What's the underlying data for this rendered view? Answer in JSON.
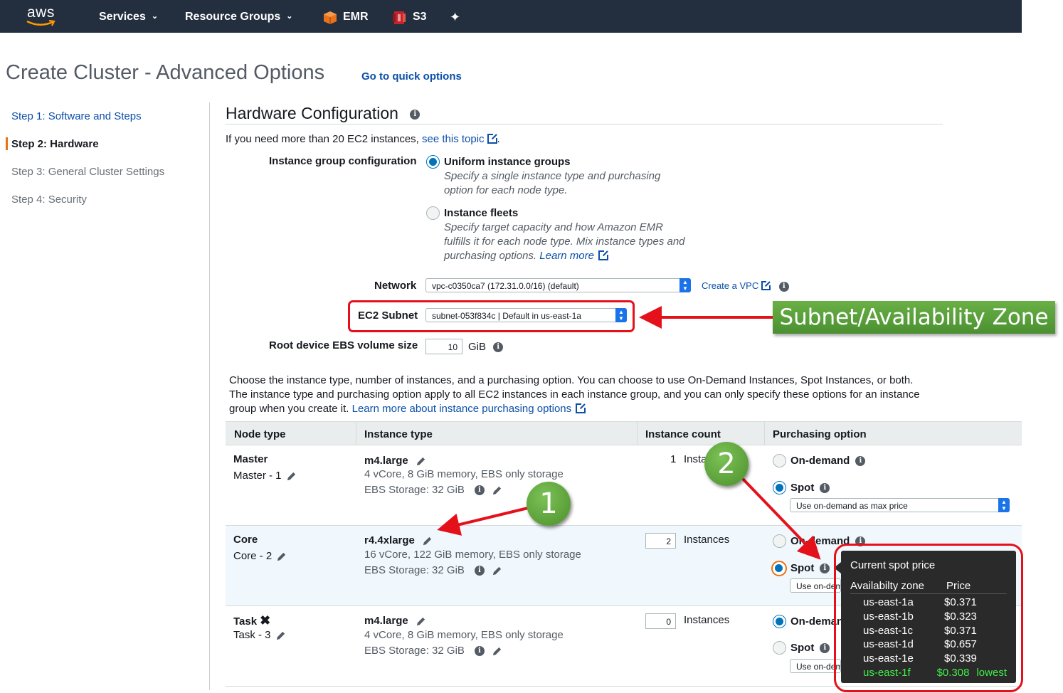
{
  "nav": {
    "logo": "aws",
    "services": "Services",
    "resource_groups": "Resource Groups",
    "emr": "EMR",
    "s3": "S3"
  },
  "page": {
    "title": "Create Cluster - Advanced Options",
    "quick_link": "Go to quick options"
  },
  "steps": [
    {
      "label": "Step 1: Software and Steps",
      "state": "link"
    },
    {
      "label": "Step 2: Hardware",
      "state": "active"
    },
    {
      "label": "Step 3: General Cluster Settings",
      "state": "muted"
    },
    {
      "label": "Step 4: Security",
      "state": "muted"
    }
  ],
  "hardware": {
    "title": "Hardware Configuration",
    "note_prefix": "If you need more than 20 EC2 instances,",
    "note_link": "see this topic",
    "note_suffix": ".",
    "instance_group_label": "Instance group configuration",
    "uniform": {
      "title": "Uniform instance groups",
      "desc1": "Specify a single instance type and purchasing",
      "desc2": "option for each node type.",
      "selected": true
    },
    "fleets": {
      "title": "Instance fleets",
      "desc1": "Specify target capacity and how Amazon EMR",
      "desc2": "fulfills it for each node type. Mix instance types and",
      "desc3": "purchasing options.",
      "learn_more": "Learn more",
      "selected": false
    },
    "network_label": "Network",
    "network_value": "vpc-c0350ca7 (172.31.0.0/16) (default)",
    "create_vpc": "Create a VPC",
    "subnet_label": "EC2 Subnet",
    "subnet_value": "subnet-053f834c | Default in us-east-1a",
    "ebs_label": "Root device EBS volume size",
    "ebs_value": "10",
    "ebs_unit": "GiB"
  },
  "callout": "Subnet/Availability Zone",
  "description": {
    "line1": "Choose the instance type, number of instances, and a purchasing option. You can choose to use On-Demand Instances, Spot Instances, or both.",
    "line2": "The instance type and purchasing option apply to all EC2 instances in each instance group, and you can only specify these options for an instance",
    "line3": "group when you create it.",
    "link": "Learn more about instance purchasing options"
  },
  "table": {
    "headers": [
      "Node type",
      "Instance type",
      "Instance count",
      "Purchasing option"
    ],
    "rows": [
      {
        "node": "Master",
        "node_sub": "Master - 1",
        "type": "m4.large",
        "spec": "4 vCore, 8 GiB memory, EBS only storage",
        "storage": "EBS Storage:  32 GiB",
        "count": "1",
        "count_unit": "Insta",
        "opt_ondemand": "On-demand",
        "opt_spot": "Spot",
        "selected": "spot",
        "select_value": "Use on-demand as max price"
      },
      {
        "node": "Core",
        "node_sub": "Core - 2",
        "type": "r4.4xlarge",
        "spec": "16 vCore, 122 GiB memory, EBS only storage",
        "storage": "EBS Storage:  32 GiB",
        "count": "2",
        "count_unit": "Instances",
        "opt_ondemand": "On-demand",
        "opt_spot": "Spot",
        "selected": "spot",
        "select_value": "Use on-dem"
      },
      {
        "node": "Task",
        "node_sub": "Task - 3",
        "type": "m4.large",
        "spec": "4 vCore, 8 GiB memory, EBS only storage",
        "storage": "EBS Storage:  32 GiB",
        "count": "0",
        "count_unit": "Instances",
        "opt_ondemand": "On-deman",
        "opt_spot": "Spot",
        "selected": "ondemand",
        "select_value": "Use on-dem"
      }
    ]
  },
  "badges": {
    "one": "1",
    "two": "2"
  },
  "spot_tooltip": {
    "title": "Current spot price",
    "col_zone": "Availabilty zone",
    "col_price": "Price",
    "rows": [
      {
        "zone": "us-east-1a",
        "price": "$0.371",
        "note": ""
      },
      {
        "zone": "us-east-1b",
        "price": "$0.323",
        "note": ""
      },
      {
        "zone": "us-east-1c",
        "price": "$0.371",
        "note": ""
      },
      {
        "zone": "us-east-1d",
        "price": "$0.657",
        "note": ""
      },
      {
        "zone": "us-east-1e",
        "price": "$0.339",
        "note": ""
      },
      {
        "zone": "us-east-1f",
        "price": "$0.308",
        "note": "lowest"
      }
    ],
    "lowest_color": "#41f04a"
  },
  "colors": {
    "nav_bg": "#232f3e",
    "link": "#0b4fa8",
    "highlight_red": "#e4111b",
    "callout_green": "#5ea33a",
    "radio_blue": "#0073bb",
    "step_marker": "#ec7211"
  }
}
